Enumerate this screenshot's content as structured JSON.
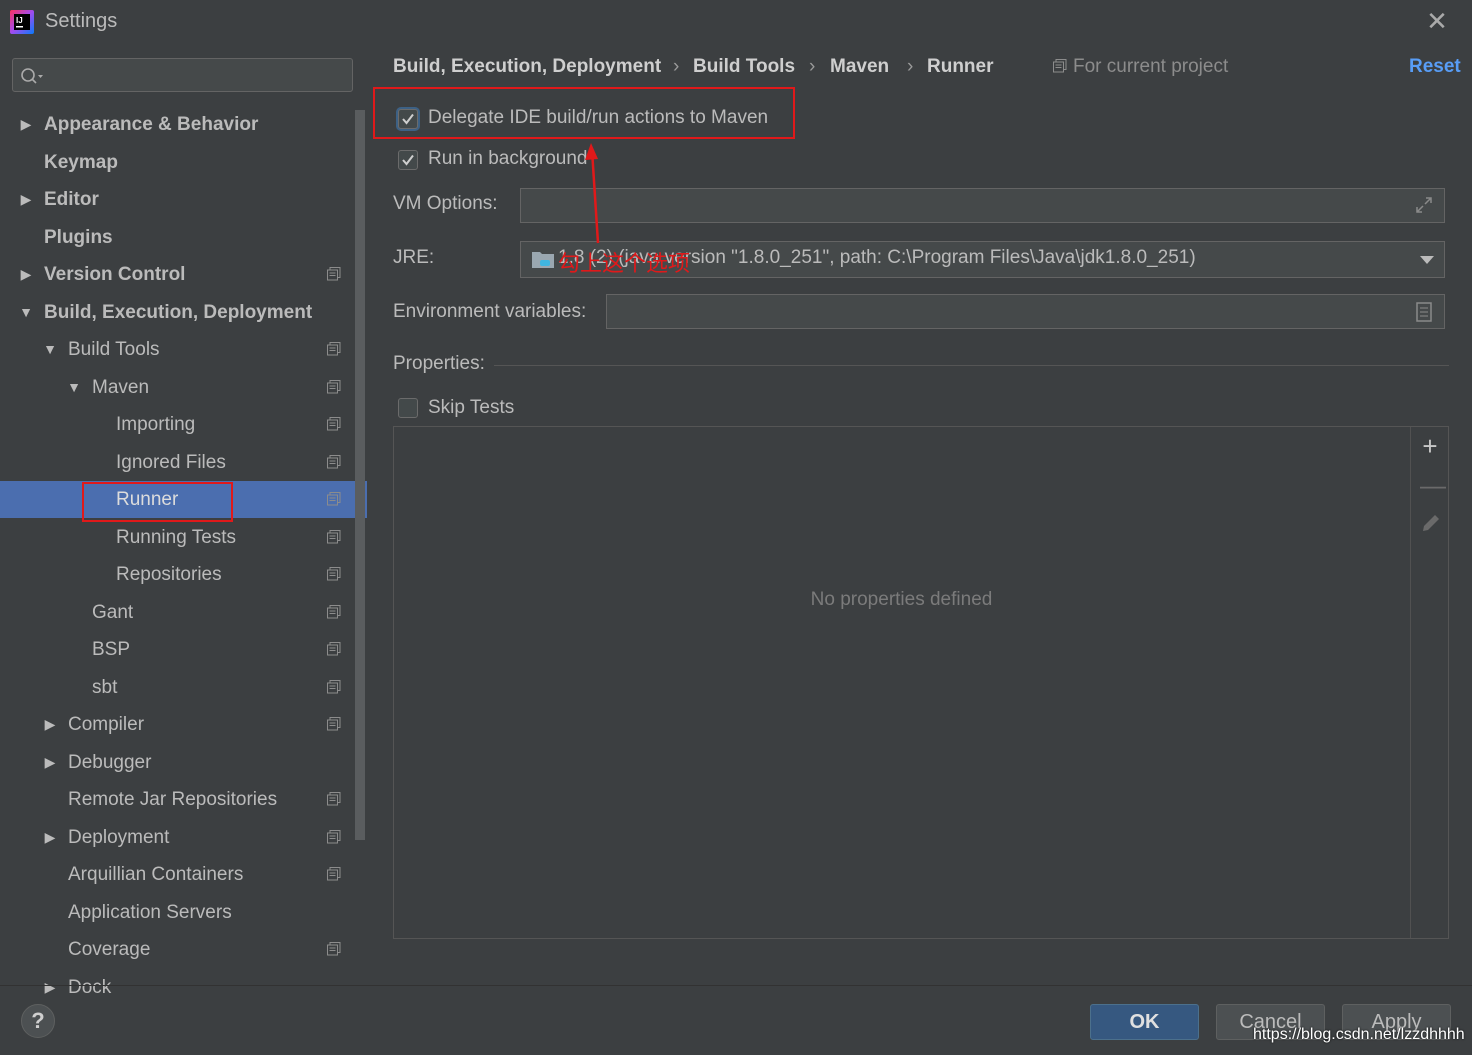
{
  "window": {
    "title": "Settings",
    "close_glyph": "✕"
  },
  "search": {
    "placeholder": ""
  },
  "sidebar": {
    "items": [
      {
        "label": "Appearance & Behavior",
        "arrow": "▶"
      },
      {
        "label": "Keymap"
      },
      {
        "label": "Editor",
        "arrow": "▶"
      },
      {
        "label": "Plugins"
      },
      {
        "label": "Version Control",
        "arrow": "▶"
      },
      {
        "label": "Build, Execution, Deployment",
        "arrow": "▼"
      },
      {
        "label": "Build Tools",
        "arrow": "▼"
      },
      {
        "label": "Maven",
        "arrow": "▼"
      },
      {
        "label": "Importing"
      },
      {
        "label": "Ignored Files"
      },
      {
        "label": "Runner"
      },
      {
        "label": "Running Tests"
      },
      {
        "label": "Repositories"
      },
      {
        "label": "Gant"
      },
      {
        "label": "BSP"
      },
      {
        "label": "sbt"
      },
      {
        "label": "Compiler",
        "arrow": "▶"
      },
      {
        "label": "Debugger",
        "arrow": "▶"
      },
      {
        "label": "Remote Jar Repositories"
      },
      {
        "label": "Deployment",
        "arrow": "▶"
      },
      {
        "label": "Arquillian Containers"
      },
      {
        "label": "Application Servers"
      },
      {
        "label": "Coverage"
      },
      {
        "label": "Dock",
        "arrow": "▶"
      }
    ]
  },
  "breadcrumb": {
    "items": [
      "Build, Execution, Deployment",
      "Build Tools",
      "Maven",
      "Runner"
    ],
    "separator": "›"
  },
  "scope": {
    "label": "For current project"
  },
  "reset": {
    "label": "Reset"
  },
  "options": {
    "delegate": {
      "label": "Delegate IDE build/run actions to Maven",
      "checked": true
    },
    "background": {
      "label": "Run in background",
      "checked": true
    },
    "skip_tests": {
      "label": "Skip Tests",
      "checked": false
    }
  },
  "vm_options": {
    "label": "VM Options:",
    "value": ""
  },
  "jre": {
    "label": "JRE:",
    "value": "1.8 (2) (java version \"1.8.0_251\", path: C:\\Program Files\\Java\\jdk1.8.0_251)"
  },
  "env": {
    "label": "Environment variables:",
    "value": ""
  },
  "properties": {
    "label": "Properties:",
    "empty_text": "No properties defined",
    "add": "+",
    "remove": "—"
  },
  "annotation": {
    "text": "勾上这个选项",
    "color": "#e0191a"
  },
  "buttons": {
    "help": "?",
    "ok": "OK",
    "cancel": "Cancel",
    "apply": "Apply"
  },
  "watermark": "https://blog.csdn.net/lzzdhhhh",
  "colors": {
    "background": "#3c3f41",
    "selection": "#4b6eaf",
    "accent": "#589df6",
    "ok": "#365880",
    "highlight": "#e0191a"
  }
}
